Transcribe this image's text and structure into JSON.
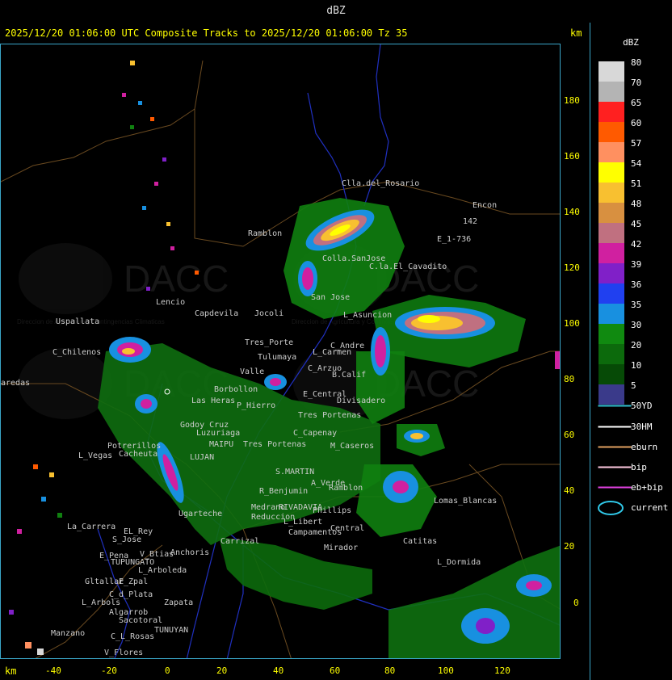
{
  "header": {
    "title": "dBZ"
  },
  "map": {
    "track_title": "2025/12/20 01:06:00 UTC Composite Tracks to 2025/12/20 01:06:00 Tz 35",
    "km_label": "km",
    "y_ticks": [
      "180",
      "160",
      "140",
      "120",
      "100",
      "80",
      "60",
      "40",
      "20",
      "0"
    ],
    "x_ticks": [
      "-40",
      "-20",
      "0",
      "20",
      "40",
      "60",
      "80",
      "100",
      "120"
    ],
    "watermark": "DACC",
    "watermark_sub": "Direccion de Agricultura y Contingencias Climaticas",
    "places": [
      "Clla.del_Rosario",
      "Encon",
      "142",
      "E_1-736",
      "Ramblon",
      "Colla.SanJose",
      "C.la.El_Cavadito",
      "San Jose",
      "L_Asuncion",
      "Jocoli",
      "Tres_Porte",
      "C_Andre",
      "Tulumaya",
      "L_Carmen",
      "C_Arzuo",
      "Valle",
      "B.Calif",
      "Capdevila",
      "Lencio",
      "Uspallata",
      "C_Chilenos",
      "E_Central",
      "Tres Portenas",
      "Divisadero",
      "P_Hierro",
      "Borbollon",
      "Las Heras",
      "C_Capenay",
      "Tres Portenas",
      "M_Caseros",
      "Godoy Cruz",
      "Luzuriaga",
      "MAIPU",
      "LUJAN",
      "Potrerillos",
      "L_Vegas",
      "Cacheuta",
      "S.MARTIN",
      "A_Verde",
      "Ramblon",
      "R_Benjumin",
      "RIVADAVIA",
      "Phillips",
      "Lomas_Blancas",
      "Ugarteche",
      "Medrano",
      "Reduccion",
      "L_Libert",
      "Campamentos",
      "Central",
      "Carrizal",
      "Mirador",
      "Catitas",
      "La_Carrera",
      "S_Jose",
      "EL_Rey",
      "E_Pena",
      "TUPUNGATO",
      "V_Btias",
      "Anchoris",
      "L_Arboleda",
      "Gltallar",
      "E_Zpal",
      "C_d_Plata",
      "L_Arbols",
      "Zapata",
      "Algarrob",
      "Sacotoral",
      "TUNUYAN",
      "Manzano",
      "C_L_Rosas",
      "V_Flores",
      "L_Dormida",
      "aredas"
    ]
  },
  "colorbar": {
    "title": "dBZ",
    "entries": [
      {
        "label": "80",
        "color": "#d8d8d8"
      },
      {
        "label": "70",
        "color": "#b4b4b4"
      },
      {
        "label": "65",
        "color": "#ff2020"
      },
      {
        "label": "60",
        "color": "#ff5a00"
      },
      {
        "label": "57",
        "color": "#ff9060"
      },
      {
        "label": "54",
        "color": "#ffff00"
      },
      {
        "label": "51",
        "color": "#f8c030"
      },
      {
        "label": "48",
        "color": "#d89040"
      },
      {
        "label": "45",
        "color": "#c07080"
      },
      {
        "label": "42",
        "color": "#d020a0"
      },
      {
        "label": "39",
        "color": "#8020c8"
      },
      {
        "label": "36",
        "color": "#2040f0"
      },
      {
        "label": "35",
        "color": "#1890e0"
      },
      {
        "label": "30",
        "color": "#108a10"
      },
      {
        "label": "20",
        "color": "#0c6a0c"
      },
      {
        "label": "10",
        "color": "#064a06"
      },
      {
        "label": "5",
        "color": "#3a3a8a"
      }
    ]
  },
  "legend": {
    "items": [
      {
        "label": "50YD",
        "color": "#30c0d0"
      },
      {
        "label": "30HM",
        "color": "#ffffff"
      },
      {
        "label": "eburn",
        "color": "#e0a060"
      },
      {
        "label": "bip",
        "color": "#ffc8e0"
      },
      {
        "label": "eb+bip",
        "color": "#e040e0"
      }
    ],
    "current_label": "current",
    "current_color": "#30c8e8"
  }
}
